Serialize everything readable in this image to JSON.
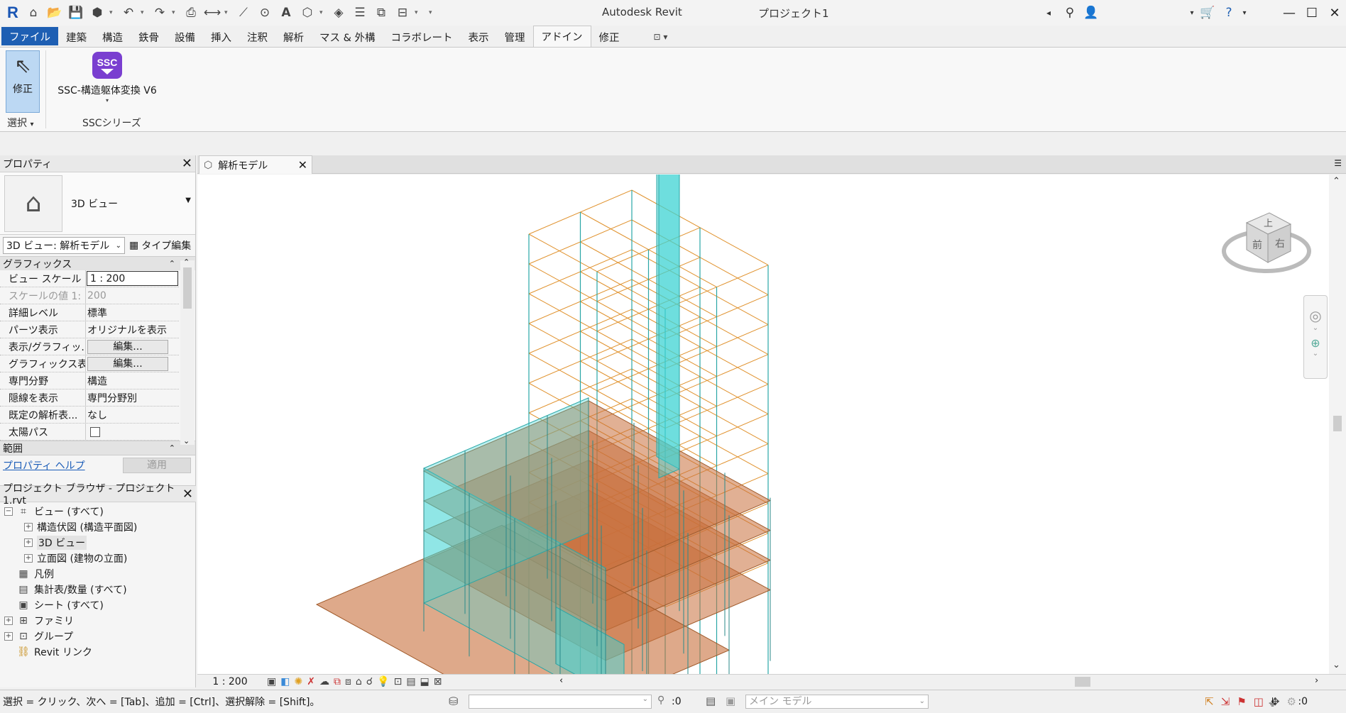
{
  "app": {
    "title": "Autodesk Revit",
    "project": "プロジェクト1"
  },
  "ribbon": {
    "tabs": [
      "ファイル",
      "建築",
      "構造",
      "鉄骨",
      "設備",
      "挿入",
      "注釈",
      "解析",
      "マス & 外構",
      "コラボレート",
      "表示",
      "管理",
      "アドイン",
      "修正"
    ],
    "active_tab": "アドイン",
    "modify_label": "修正",
    "select_panel": "選択",
    "ssc_icon_text": "SSC",
    "ssc_button": "SSC-構造躯体変換 V6",
    "ssc_panel": "SSCシリーズ"
  },
  "properties": {
    "title": "プロパティ",
    "type_name": "3D ビュー",
    "instance_selector": "3D ビュー: 解析モデル",
    "type_edit": "タイプ編集",
    "group_graphics": "グラフィックス",
    "rows": [
      {
        "key": "ビュー スケール",
        "value": "1 : 200",
        "kind": "input"
      },
      {
        "key": "スケールの値    1:",
        "value": "200",
        "kind": "disabled"
      },
      {
        "key": "詳細レベル",
        "value": "標準",
        "kind": "text"
      },
      {
        "key": "パーツ表示",
        "value": "オリジナルを表示",
        "kind": "text"
      },
      {
        "key": "表示/グラフィッ...",
        "value": "編集...",
        "kind": "button"
      },
      {
        "key": "グラフィックス表...",
        "value": "編集...",
        "kind": "button"
      },
      {
        "key": "専門分野",
        "value": "構造",
        "kind": "text"
      },
      {
        "key": "隠線を表示",
        "value": "専門分野別",
        "kind": "text"
      },
      {
        "key": "既定の解析表...",
        "value": "なし",
        "kind": "text"
      },
      {
        "key": "太陽パス",
        "value": "",
        "kind": "checkbox"
      }
    ],
    "group_extents": "範囲",
    "help_link": "プロパティ ヘルプ",
    "apply": "適用"
  },
  "browser": {
    "title": "プロジェクト ブラウザ - プロジェクト1.rvt",
    "items": [
      {
        "label": "ビュー (すべて)",
        "level": 0,
        "expander": "−",
        "icon": "views-icon"
      },
      {
        "label": "構造伏図 (構造平面図)",
        "level": 1,
        "expander": "+",
        "icon": ""
      },
      {
        "label": "3D ビュー",
        "level": 1,
        "expander": "+",
        "icon": "",
        "highlight": true
      },
      {
        "label": "立面図 (建物の立面)",
        "level": 1,
        "expander": "+",
        "icon": ""
      },
      {
        "label": "凡例",
        "level": 0,
        "expander": "",
        "icon": "legend-icon"
      },
      {
        "label": "集計表/数量 (すべて)",
        "level": 0,
        "expander": "",
        "icon": "schedule-icon"
      },
      {
        "label": "シート (すべて)",
        "level": 0,
        "expander": "",
        "icon": "sheet-icon"
      },
      {
        "label": "ファミリ",
        "level": 0,
        "expander": "+",
        "icon": "family-icon"
      },
      {
        "label": "グループ",
        "level": 0,
        "expander": "+",
        "icon": "group-icon"
      },
      {
        "label": "Revit リンク",
        "level": 0,
        "expander": "",
        "icon": "link-icon"
      }
    ]
  },
  "view": {
    "tab_title": "解析モデル",
    "scale": "1 : 200",
    "cube_labels": {
      "top": "上",
      "front": "前",
      "right": "右"
    }
  },
  "status": {
    "text": "選択 = クリック、次へ = [Tab]、追加 = [Ctrl]、選択解除 = [Shift]。",
    "zero": ":0",
    "model": "メイン モデル",
    "filter_count": ":0"
  },
  "colors": {
    "accent": "#1e5fb3",
    "ssc": "#7a3fd0",
    "wall": "#3fd3d3",
    "slab": "#c8703c",
    "beam": "#e0922e"
  }
}
